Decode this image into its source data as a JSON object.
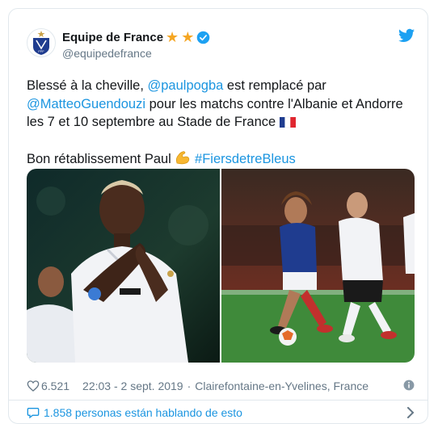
{
  "account": {
    "display_name": "Equipe de France",
    "handle": "@equipedefrance",
    "badges": [
      "star",
      "star"
    ],
    "verified": true,
    "avatar_icon": "fff-crest-icon"
  },
  "tweet": {
    "line1_prefix": "Blessé à la cheville, ",
    "mention1": "@paulpogba",
    "line1_suffix": " est remplacé par",
    "mention2": "@MatteoGuendouzi",
    "line2_suffix": " pour les matchs contre l'Albanie et Andorre",
    "line3": "les 7 et 10 septembre au Stade de France ",
    "flag_icon": "france-flag-icon",
    "line4_prefix": "Bon rétablissement Paul ",
    "muscle_icon": "flexed-biceps-icon",
    "hashtag": "#FiersdetreBleus"
  },
  "media": {
    "photos": [
      {
        "icon": "photo-pogba-applauding"
      },
      {
        "icon": "photo-guendouzi-dribbling"
      }
    ]
  },
  "meta": {
    "likes": "6.521",
    "time": "22:03 - 2 sept. 2019",
    "separator": "·",
    "location": "Clairefontaine-en-Yvelines, France"
  },
  "conversation": {
    "label": "1.858 personas están hablando de esto"
  },
  "colors": {
    "link": "#1b95e0",
    "secondary_text": "#657786",
    "border": "#e1e8ed",
    "star": "#f5a623",
    "verified": "#1da1f2",
    "france_blue": "#1f3c8f"
  }
}
